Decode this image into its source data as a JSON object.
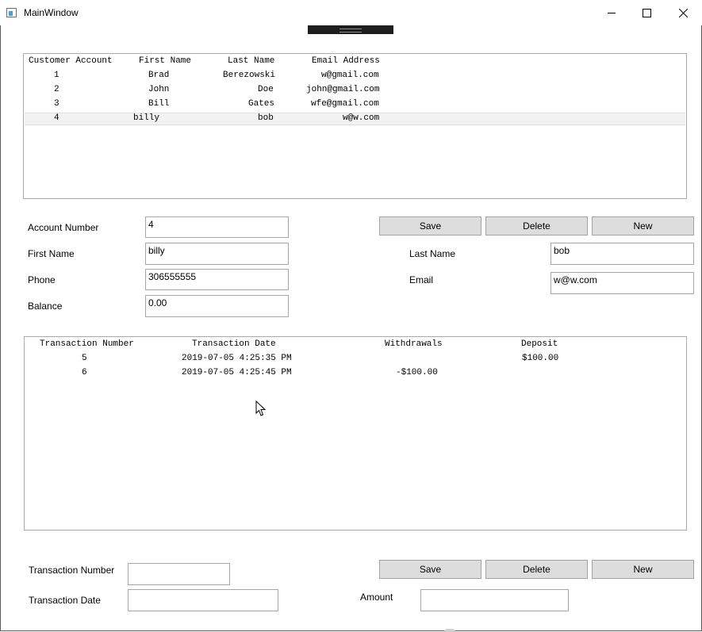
{
  "window": {
    "title": "MainWindow",
    "controls": [
      "minimize-icon",
      "maximize-icon",
      "close-icon"
    ]
  },
  "customers": {
    "columns": [
      "Customer Account",
      "First Name",
      "Last Name",
      "Email Address"
    ],
    "rows": [
      [
        "1",
        "Brad",
        "Berezowski",
        "w@gmail.com"
      ],
      [
        "2",
        "John",
        "Doe",
        "john@gmail.com"
      ],
      [
        "3",
        "Bill",
        "Gates",
        "wfe@gmail.com"
      ],
      [
        "4",
        "billy",
        "bob",
        "w@w.com"
      ]
    ],
    "selected_row": 3
  },
  "customer_form": {
    "account_number_label": "Account Number",
    "account_number_value": "4",
    "first_name_label": "First Name",
    "first_name_value": "billy",
    "phone_label": "Phone",
    "phone_value": "306555555",
    "balance_label": "Balance",
    "balance_value": "0.00",
    "last_name_label": "Last Name",
    "last_name_value": "bob",
    "email_label": "Email",
    "email_value": "w@w.com",
    "save_label": "Save",
    "delete_label": "Delete",
    "new_label": "New"
  },
  "transactions": {
    "columns": [
      "Transaction Number",
      "Transaction Date",
      "Withdrawals",
      "Deposit"
    ],
    "rows": [
      [
        "5",
        "2019-07-05 4:25:35 PM",
        "",
        "$100.00"
      ],
      [
        "6",
        "2019-07-05 4:25:45 PM",
        "-$100.00",
        ""
      ]
    ]
  },
  "transaction_form": {
    "transaction_number_label": "Transaction Number",
    "transaction_number_value": "",
    "transaction_date_label": "Transaction Date",
    "transaction_date_value": "",
    "amount_label": "Amount",
    "amount_value": "",
    "save_label": "Save",
    "delete_label": "Delete",
    "new_label": "New"
  },
  "colors": {
    "button_bg": "#dddddd",
    "border": "#a6a6a6",
    "selected_row": "#f2f2f2"
  }
}
